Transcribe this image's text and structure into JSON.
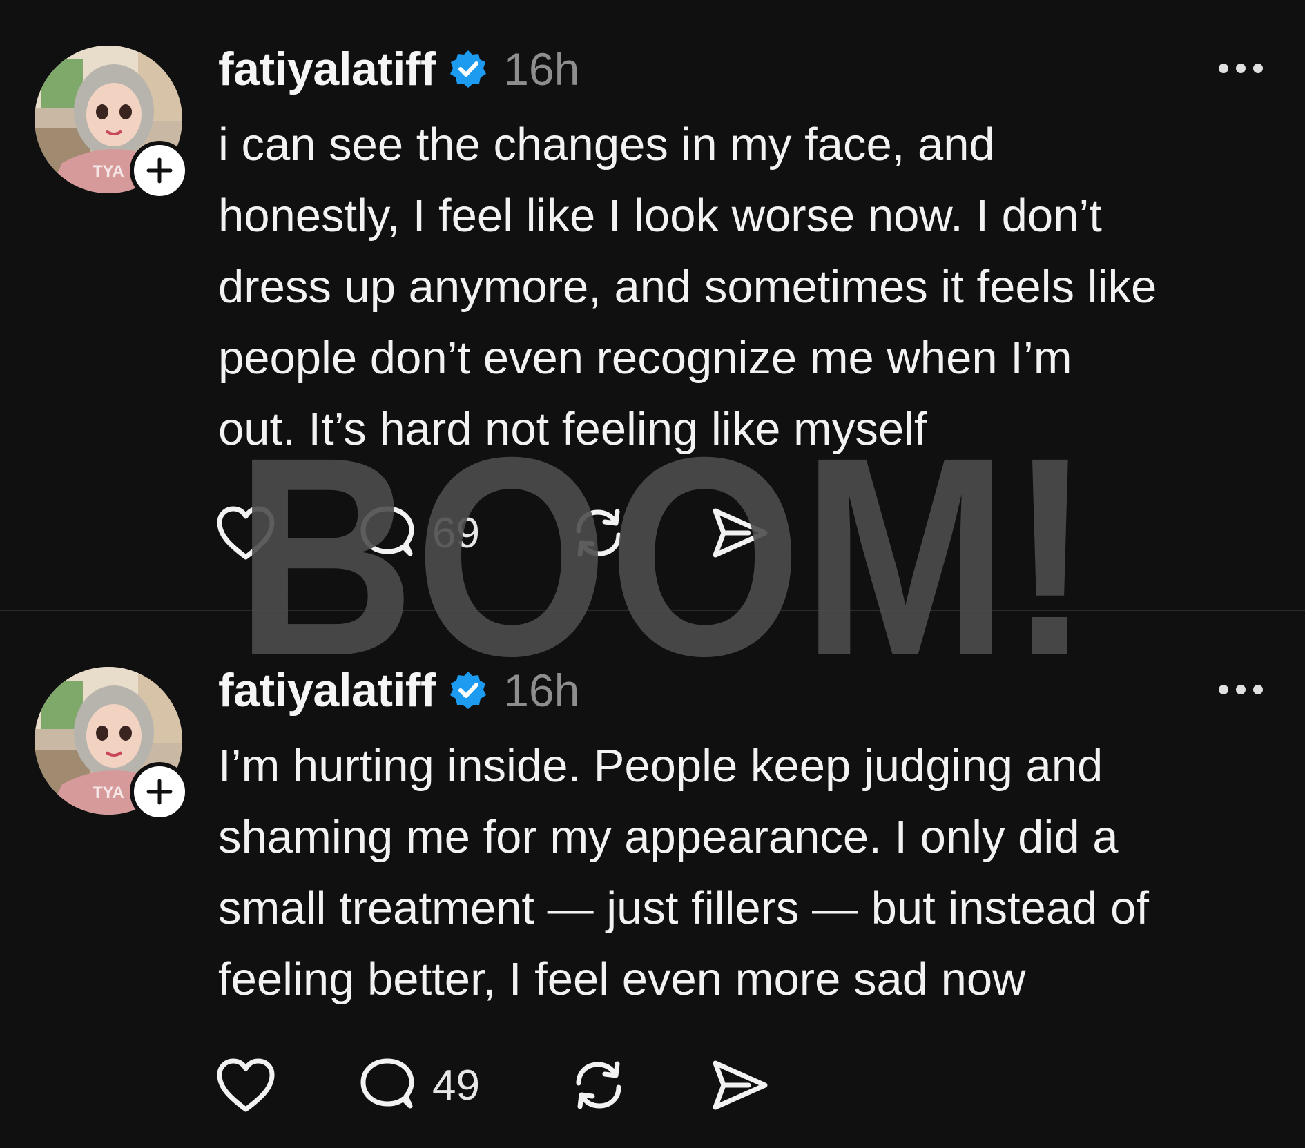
{
  "posts": [
    {
      "username": "fatiyalatiff",
      "verified": true,
      "time": "16h",
      "text": "i can see the changes in my face, and\nhonestly, I feel like I look worse now. I don’t\ndress up anymore, and sometimes it feels like\npeople don’t even recognize me when I’m\nout. It’s hard not feeling like myself",
      "comments": "69"
    },
    {
      "username": "fatiyalatiff",
      "verified": true,
      "time": "16h",
      "text": "I’m hurting inside. People keep judging and\nshaming me for my appearance. I only did a\nsmall treatment — just fillers — but instead of\nfeeling better, I feel even more sad now",
      "comments": "49"
    }
  ],
  "watermark": "BOOM!",
  "colors": {
    "background": "#101010",
    "verified_badge": "#1d9bf0",
    "muted_text": "#8e8e8e",
    "watermark": "#4d4d4d"
  },
  "icons": [
    "plus-icon",
    "verified-icon",
    "more-icon",
    "heart-icon",
    "comment-icon",
    "repost-icon",
    "share-icon"
  ]
}
